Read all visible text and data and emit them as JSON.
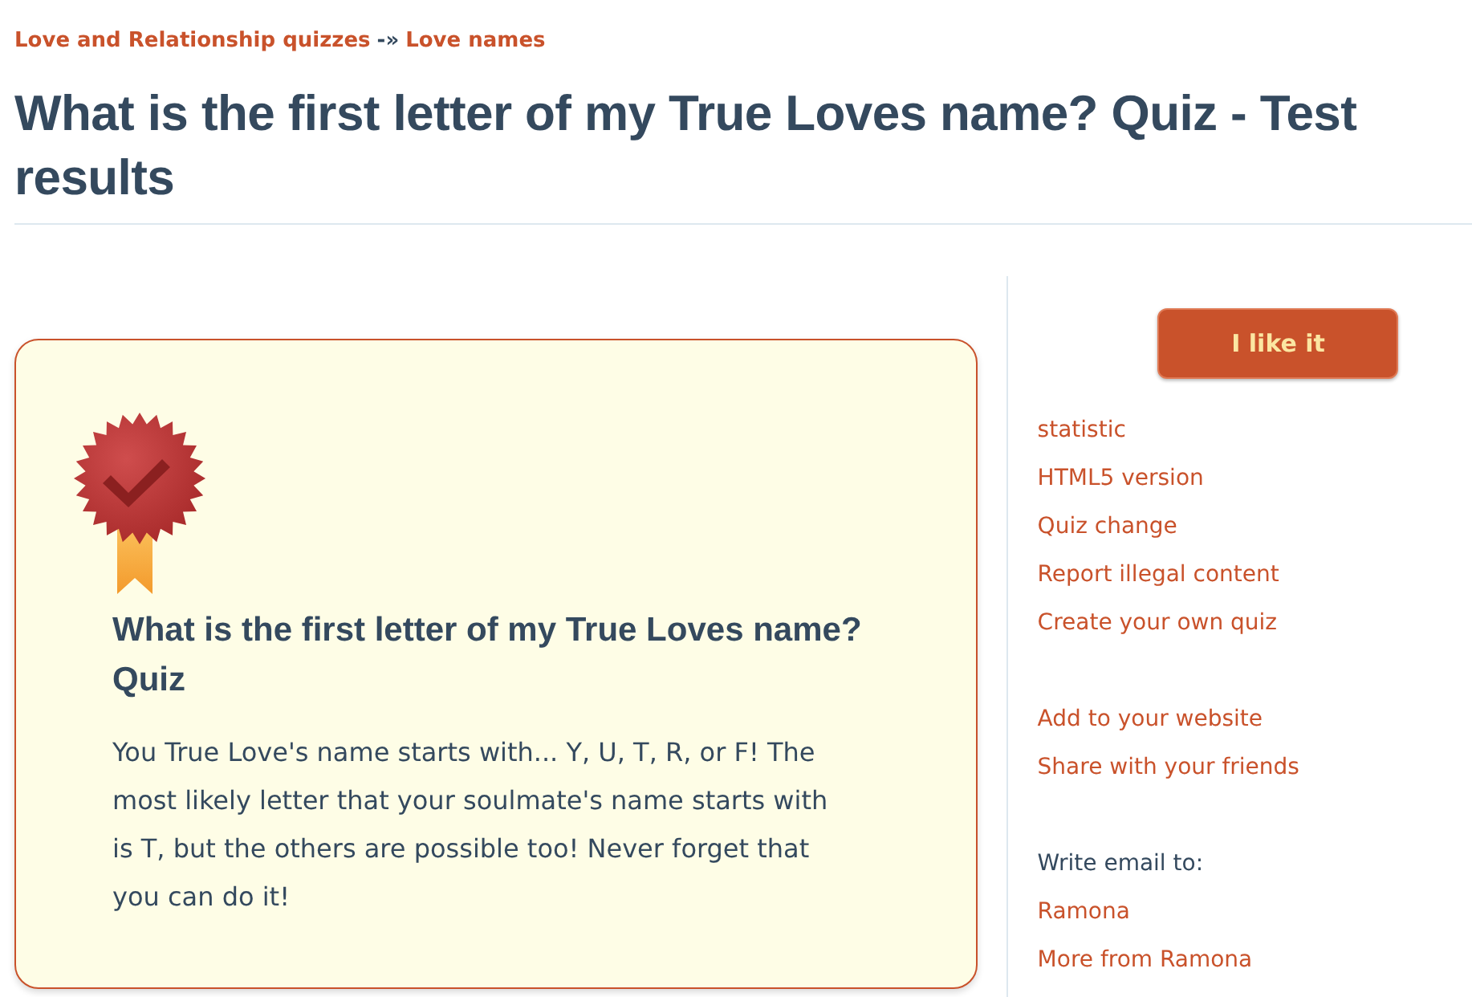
{
  "breadcrumb": {
    "links": [
      "Love and Relationship quizzes",
      "Love names"
    ],
    "separator": "-»"
  },
  "title": "What is the first letter of my True Loves name? Quiz - Test results",
  "result": {
    "heading": "What is the first letter of my True Loves name? Quiz",
    "text": "You True Love's name starts with... Y, U, T, R, or F! The most likely letter that your soulmate's name starts with is T, but the others are possible too! Never forget that you can do it!"
  },
  "sidebar": {
    "button": "I like it",
    "link_groups": [
      [
        "statistic",
        "HTML5 version",
        "Quiz change",
        "Report illegal content",
        "Create your own quiz"
      ],
      [
        "Add to your website",
        "Share with your friends"
      ]
    ],
    "email_label": "Write email to:",
    "email_links": [
      "Ramona",
      "More from Ramona"
    ]
  }
}
